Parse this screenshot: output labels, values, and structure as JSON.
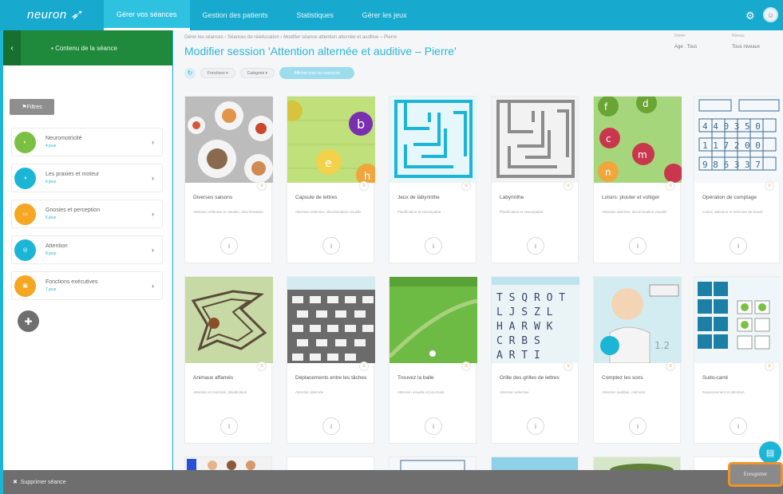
{
  "app": {
    "logo": "neuron"
  },
  "nav": {
    "items": [
      "Gérer vos séances",
      "Gestion des patients",
      "Statistiques",
      "Gérer les jeux"
    ],
    "active_index": 0
  },
  "header_icons": [
    "gear-icon",
    "avatar"
  ],
  "sidebar": {
    "head_label": "Contenu de la séance",
    "filter_label": "Filtres",
    "categories": [
      {
        "name": "Neuromotricité",
        "sub": "4 jeux",
        "color": "#7ac143"
      },
      {
        "name": "Les praxies et moteur",
        "sub": "6 jeux",
        "color": "#1db5d6"
      },
      {
        "name": "Gnosies et perception",
        "sub": "5 jeux",
        "color": "#f5a623"
      },
      {
        "name": "Attention",
        "sub": "8 jeux",
        "color": "#1db5d6"
      },
      {
        "name": "Fonctions exécutives",
        "sub": "7 jeux",
        "color": "#f5a623"
      }
    ]
  },
  "main": {
    "breadcrumb": "Gérer les séances  ›  Séances de rééducation  ›  Modifier séance attention alternée et auditive – Pierre",
    "title": "Modifier session 'Attention alternée et auditive – Pierre'",
    "duration_label": "Durée",
    "duration_value": "Age : Tous",
    "level_label": "Niveau",
    "level_value": "Tous niveaux",
    "toolbar": {
      "filter1": "Fonctions",
      "filter2": "Catégorie",
      "pill": "Afficher tous les exercices"
    }
  },
  "cards": [
    {
      "title": "Diverses saisons",
      "desc": "Attention sélective et visuelle, discrimination"
    },
    {
      "title": "Capsule de lettres",
      "desc": "Attention sélective, discrimination visuelle"
    },
    {
      "title": "Jeux de labyrinthe",
      "desc": "Planification et visuospatial"
    },
    {
      "title": "Labyrinthe",
      "desc": "Planification et visuospatial"
    },
    {
      "title": "Loisirs: plouter et voltiger",
      "desc": "Attention alternée, discrimination visuelle"
    },
    {
      "title": "Opération de comptage",
      "desc": "Calcul, attention et mémoire de travail"
    },
    {
      "title": "Animaux affamés",
      "desc": "Attention et motricité, planification"
    },
    {
      "title": "Déplacements entre les tâches",
      "desc": "Attention alternée"
    },
    {
      "title": "Trouvez la balle",
      "desc": "Attention visuelle et poursuite"
    },
    {
      "title": "Grille des grilles de lettres",
      "desc": "Attention sélective"
    },
    {
      "title": "Comptez les sons",
      "desc": "Attention auditive, mémoire"
    },
    {
      "title": "Sudo-carré",
      "desc": "Raisonnement et attention"
    }
  ],
  "bottom": {
    "left_label": "Supprimer séance",
    "save_label": "Enregistrer"
  }
}
